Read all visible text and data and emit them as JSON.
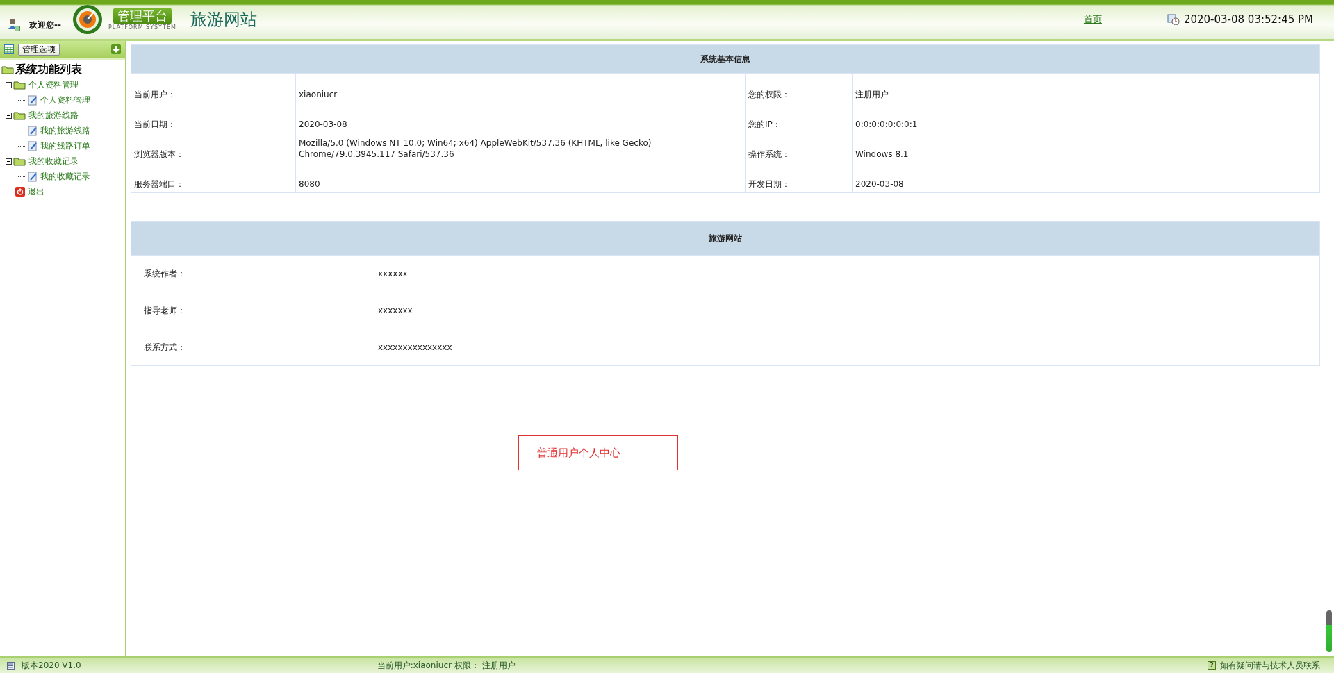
{
  "header": {
    "welcome": "欢迎您--",
    "badge_title": "管理平台",
    "badge_subtitle": "PLATFORM SYSYTEM",
    "site_title": "旅游网站",
    "home_link": "首页",
    "datetime": "2020-03-08 03:52:45 PM"
  },
  "sidebar": {
    "options_button": "管理选项",
    "tree_root": "系统功能列表",
    "items": [
      {
        "label": "个人资料管理",
        "kind": "folder",
        "expanded": true,
        "children": [
          {
            "label": "个人资料管理",
            "kind": "page"
          }
        ]
      },
      {
        "label": "我的旅游线路",
        "kind": "folder",
        "expanded": true,
        "children": [
          {
            "label": "我的旅游线路",
            "kind": "page"
          },
          {
            "label": "我的线路订单",
            "kind": "page"
          }
        ]
      },
      {
        "label": "我的收藏记录",
        "kind": "folder",
        "expanded": true,
        "children": [
          {
            "label": "我的收藏记录",
            "kind": "page"
          }
        ]
      },
      {
        "label": "退出",
        "kind": "exit"
      }
    ]
  },
  "system_info": {
    "title": "系统基本信息",
    "rows": [
      [
        "当前用户：",
        "xiaoniucr",
        "您的权限：",
        "注册用户"
      ],
      [
        "当前日期：",
        "2020-03-08",
        "您的IP：",
        "0:0:0:0:0:0:0:1"
      ],
      [
        "浏览器版本：",
        "Mozilla/5.0 (Windows NT 10.0; Win64; x64) AppleWebKit/537.36 (KHTML, like Gecko) Chrome/79.0.3945.117 Safari/537.36",
        "操作系统：",
        "Windows 8.1"
      ],
      [
        "服务器端口：",
        "8080",
        "开发日期：",
        "2020-03-08"
      ]
    ]
  },
  "site_info": {
    "title": "旅游网站",
    "rows": [
      [
        "系统作者：",
        "xxxxxx"
      ],
      [
        "指导老师：",
        "xxxxxxx"
      ],
      [
        "联系方式：",
        "xxxxxxxxxxxxxxx"
      ]
    ]
  },
  "center_label": "普通用户个人中心",
  "status_bar": {
    "version": "版本2020 V1.0",
    "user_info": "当前用户:xiaoniucr 权限： 注册用户",
    "help_icon": "?",
    "help": "如有疑问请与技术人员联系"
  }
}
